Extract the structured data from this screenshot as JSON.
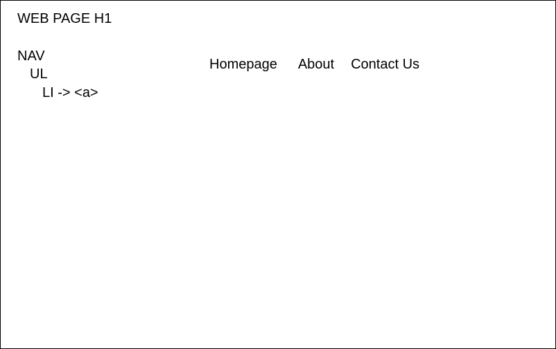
{
  "diagram": {
    "title": "WEB PAGE H1",
    "structure": {
      "nav": "NAV",
      "ul": "UL",
      "li": "LI -> <a>"
    },
    "nav_links": [
      {
        "label": "Homepage"
      },
      {
        "label": "About"
      },
      {
        "label": "Contact Us"
      }
    ],
    "colors": {
      "border": "#000000",
      "text": "#000000",
      "background": "#ffffff"
    }
  }
}
